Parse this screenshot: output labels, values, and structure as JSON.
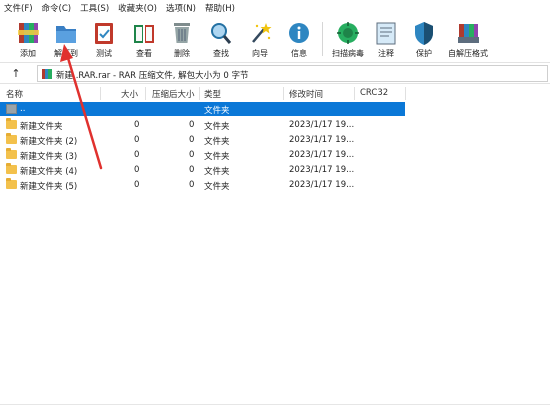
{
  "menu": [
    "文件(F)",
    "命令(C)",
    "工具(S)",
    "收藏夹(O)",
    "选项(N)",
    "帮助(H)"
  ],
  "toolbar": {
    "add": "添加",
    "extract": "解压到",
    "test": "测试",
    "view": "查看",
    "delete": "删除",
    "find": "查找",
    "wizard": "向导",
    "info": "信息",
    "virus_scan": "扫描病毒",
    "comment": "注释",
    "protect": "保护",
    "sfx": "自解压格式"
  },
  "address": {
    "text": "新建 .RAR.rar - RAR 压缩文件, 解包大小为 0 字节"
  },
  "columns": {
    "name": "名称",
    "size": "大小",
    "packed": "压缩后大小",
    "type": "类型",
    "modified": "修改时间",
    "crc": "CRC32"
  },
  "rows": [
    {
      "name": "..",
      "size": "",
      "packed": "",
      "type": "文件夹",
      "modified": ""
    },
    {
      "name": "新建文件夹",
      "size": "0",
      "packed": "0",
      "type": "文件夹",
      "modified": "2023/1/17 19..."
    },
    {
      "name": "新建文件夹 (2)",
      "size": "0",
      "packed": "0",
      "type": "文件夹",
      "modified": "2023/1/17 19..."
    },
    {
      "name": "新建文件夹 (3)",
      "size": "0",
      "packed": "0",
      "type": "文件夹",
      "modified": "2023/1/17 19..."
    },
    {
      "name": "新建文件夹 (4)",
      "size": "0",
      "packed": "0",
      "type": "文件夹",
      "modified": "2023/1/17 19..."
    },
    {
      "name": "新建文件夹 (5)",
      "size": "0",
      "packed": "0",
      "type": "文件夹",
      "modified": "2023/1/17 19..."
    }
  ],
  "colors": {
    "selection": "#0b78d7",
    "annotation_arrow": "#e0312e"
  }
}
